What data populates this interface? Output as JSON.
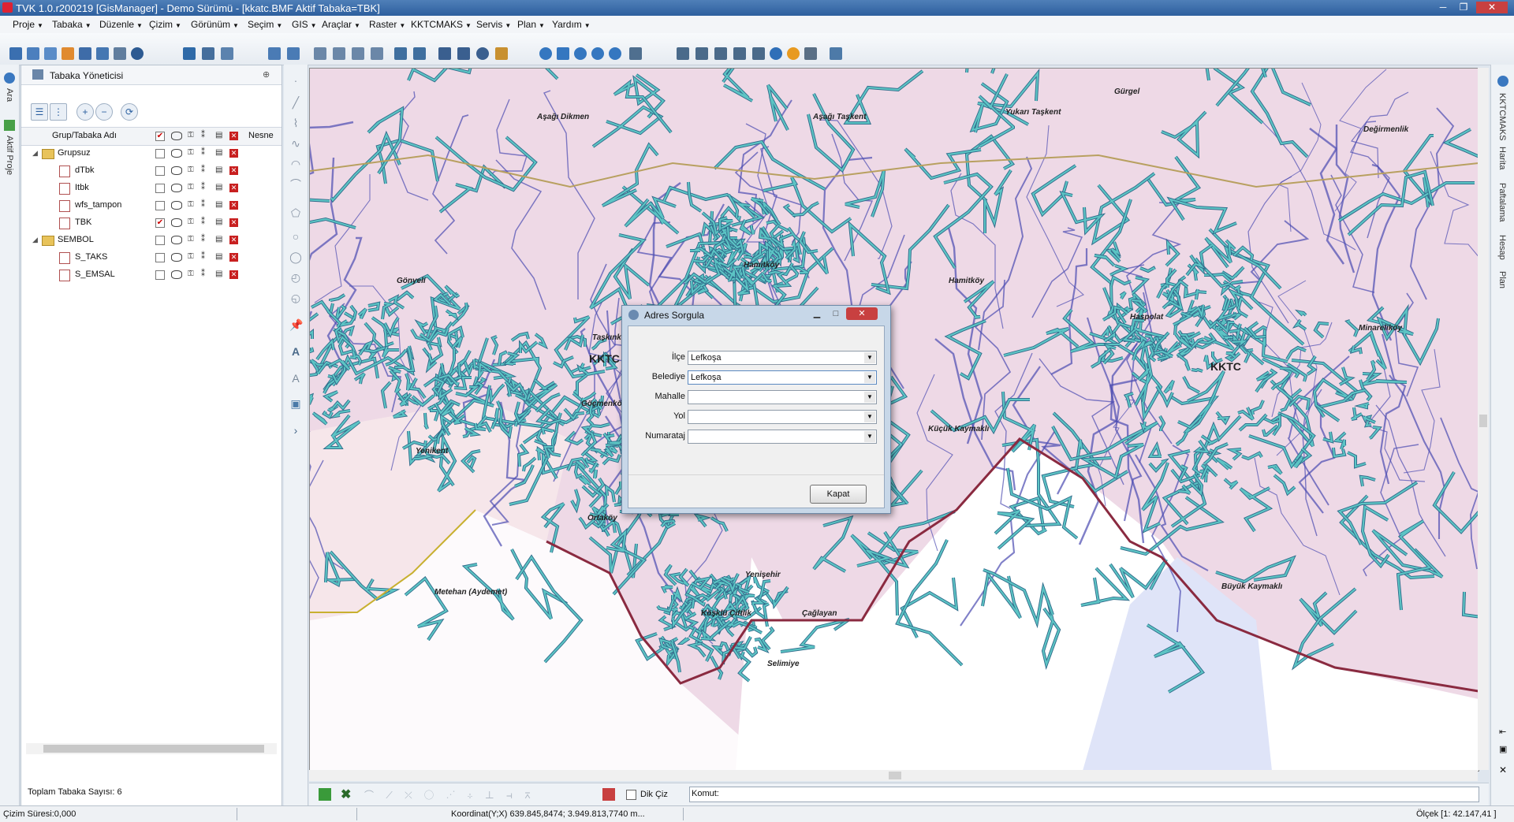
{
  "window": {
    "title": "TVK 1.0.r200219 [GisManager] - Demo Sürümü - [kkatc.BMF  Aktif Tabaka=TBK]",
    "minimize": "─",
    "restore": "❐",
    "close": "✕"
  },
  "menubar": [
    {
      "label": "Proje"
    },
    {
      "label": "Tabaka"
    },
    {
      "label": "Düzenle"
    },
    {
      "label": "Çizim"
    },
    {
      "label": "Görünüm"
    },
    {
      "label": "Seçim"
    },
    {
      "label": "GIS"
    },
    {
      "label": "Araçlar"
    },
    {
      "label": "Raster"
    },
    {
      "label": "KKTCMAKS"
    },
    {
      "label": "Servis"
    },
    {
      "label": "Plan"
    },
    {
      "label": "Yardım"
    }
  ],
  "left_strip": {
    "search_label": "Ara",
    "active_project_label": "Aktif Proje"
  },
  "layer_panel": {
    "title": "Tabaka Yöneticisi",
    "pin": "⊕",
    "column_name": "Grup/Tabaka Adı",
    "column_object": "Nesne",
    "rows": [
      {
        "label": "Grupsuz",
        "type": "group",
        "checked": false
      },
      {
        "label": "dTbk",
        "type": "layer",
        "checked": false
      },
      {
        "label": "Itbk",
        "type": "layer",
        "checked": false
      },
      {
        "label": "wfs_tampon",
        "type": "layer",
        "checked": false
      },
      {
        "label": "TBK",
        "type": "layer",
        "checked": true
      },
      {
        "label": "SEMBOL",
        "type": "group",
        "checked": false
      },
      {
        "label": "S_TAKS",
        "type": "layer",
        "checked": false
      },
      {
        "label": "S_EMSAL",
        "type": "layer",
        "checked": false
      }
    ],
    "footer": "Toplam Tabaka Sayısı: 6"
  },
  "right_strip": {
    "labels": [
      "KKTCMAKS",
      "Harita",
      "Paftalama",
      "Hesap",
      "Plan"
    ]
  },
  "map": {
    "big_labels": [
      "KKTC",
      "KKTC"
    ],
    "places": [
      "Aşağı Dikmen",
      "Aşağı Taşkent",
      "Yukarı Taşkent",
      "Gönyeli",
      "Hamitköy",
      "Hamitköy",
      "Haspolat",
      "Minareliköy",
      "Taşkınköy",
      "Göçmenköy",
      "Küçük Kaymaklı",
      "Yenikent",
      "Ortaköy",
      "Metehan (Aydemet)",
      "Yenişehir",
      "Köşklü Çiftlik",
      "Çağlayan",
      "Selimiye",
      "Büyük Kaymaklı",
      "Gürgel",
      "Değirmenlik"
    ]
  },
  "dialog": {
    "title": "Adres Sorgula",
    "fields": [
      {
        "label": "İlçe",
        "value": "Lefkoşa"
      },
      {
        "label": "Belediye",
        "value": "Lefkoşa"
      },
      {
        "label": "Mahalle",
        "value": ""
      },
      {
        "label": "Yol",
        "value": ""
      },
      {
        "label": "Numarataj",
        "value": ""
      }
    ],
    "close_button": "Kapat"
  },
  "command_bar": {
    "ortho_label": "Dik Çiz",
    "command_label": "Komut:"
  },
  "status": {
    "draw_time": "Çizim Süresi:0,000",
    "coordinates": "Koordinat(Y;X)  639.845,8474; 3.949.813,7740 m...",
    "scale": "Ölçek [1: 42.147,41 ]"
  },
  "colors": {
    "map_background": "#eed9e6",
    "road": "#5cc4c4",
    "road_outline": "#2f6a8a",
    "boundary": "#8a2a40",
    "stream": "#4a4ab0",
    "dialog_frame": "#c7d7e8"
  }
}
